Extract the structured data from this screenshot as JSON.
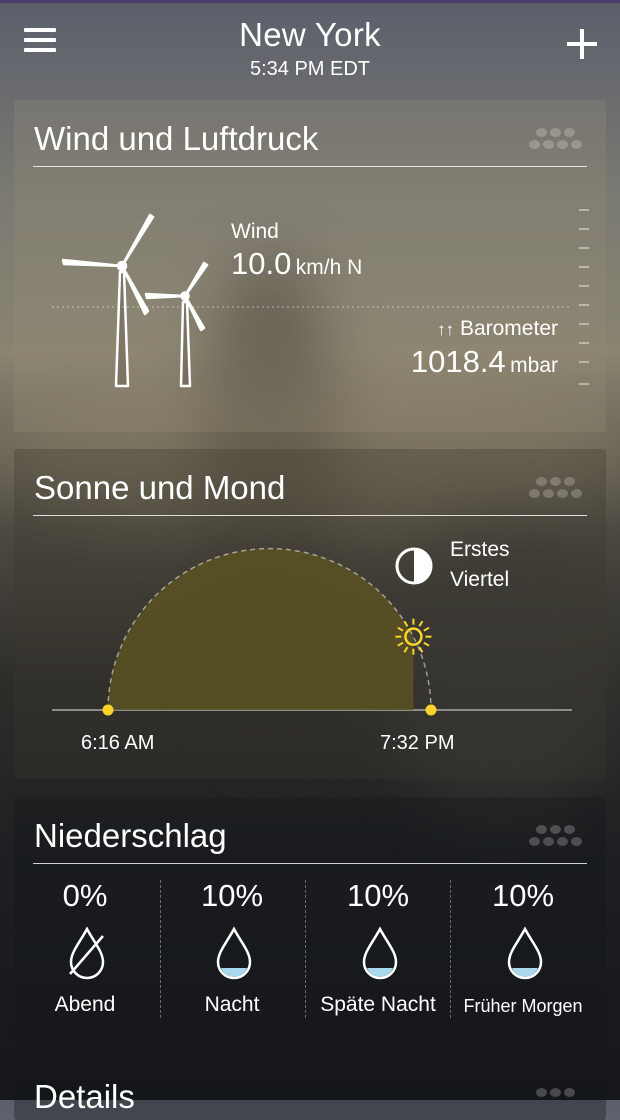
{
  "header": {
    "city": "New York",
    "time": "5:34 PM EDT",
    "menu_icon": "hamburger-menu-icon",
    "add_icon": "plus-icon"
  },
  "wind_card": {
    "title": "Wind und Luftdruck",
    "wind_label": "Wind",
    "wind_value": "10.0",
    "wind_unit": "km/h N",
    "barometer_trend": "↑↑",
    "barometer_label": "Barometer",
    "barometer_value": "1018.4",
    "barometer_unit": "mbar",
    "icon": "wind-turbine-icon"
  },
  "sun_card": {
    "title": "Sonne und Mond",
    "moon_phase_line1": "Erstes",
    "moon_phase_line2": "Viertel",
    "moon_icon": "first-quarter-moon-icon",
    "sun_icon": "sun-icon",
    "sunrise": "6:16 AM",
    "sunset": "7:32 PM",
    "daylight_progress": 0.85,
    "sun_color": "#ffd42a",
    "arc_fill_color": "#5a5222"
  },
  "precip_card": {
    "title": "Niederschlag",
    "columns": [
      {
        "percent": "0%",
        "label": "Abend",
        "icon": "no-rain-drop-icon"
      },
      {
        "percent": "10%",
        "label": "Nacht",
        "icon": "rain-drop-icon"
      },
      {
        "percent": "10%",
        "label": "Späte Nacht",
        "icon": "rain-drop-icon"
      },
      {
        "percent": "10%",
        "label": "Früher Morgen",
        "icon": "rain-drop-icon"
      }
    ]
  },
  "details_card": {
    "title": "Details"
  }
}
